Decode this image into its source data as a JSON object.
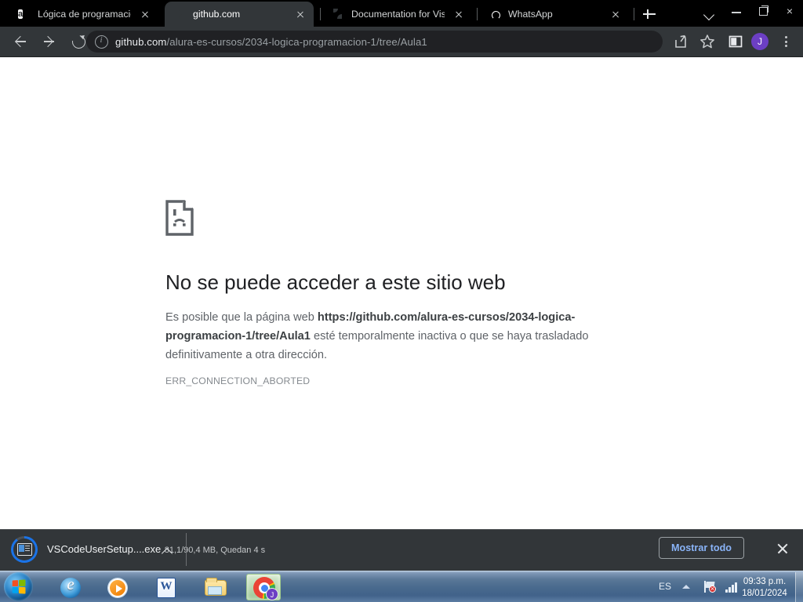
{
  "window": {
    "controls": {
      "minimize": "minimize-button",
      "restore": "restore-button",
      "close": "close-button",
      "close_glyph": "×"
    }
  },
  "tabs": [
    {
      "title": "Lógica de programación:",
      "favicon": "alura-icon",
      "favicon_letter": "a",
      "active": false
    },
    {
      "title": "github.com",
      "favicon": "globe-icon",
      "favicon_letter": "",
      "active": true
    },
    {
      "title": "Documentation for Visual",
      "favicon": "globe-icon",
      "favicon_letter": "",
      "active": false
    },
    {
      "title": "WhatsApp",
      "favicon": "whatsapp-icon",
      "favicon_letter": "",
      "active": false
    }
  ],
  "tabstrip": {
    "new_tab_label": "+",
    "tab_list_label": "⌄"
  },
  "toolbar": {
    "back_label": "←",
    "forward_label": "→",
    "reload_label": "↻",
    "url_domain": "github.com",
    "url_path": "/alura-es-cursos/2034-logica-programacion-1/tree/Aula1",
    "url_full": "github.com/alura-es-cursos/2034-logica-programacion-1/tree/Aula1",
    "share_label": "share-icon",
    "bookmark_label": "star-icon",
    "side_panel_label": "side-panel-icon",
    "avatar_letter": "J",
    "menu_label": "kebab-menu-icon"
  },
  "page": {
    "icon": "sad-page-icon",
    "title": "No se puede acceder a este sitio web",
    "body_prefix": "Es posible que la página web ",
    "body_url": "https://github.com/alura-es-cursos/2034-logica-programacion-1/tree/Aula1",
    "body_suffix": " esté temporalmente inactiva o que se haya trasladado definitivamente a otra dirección.",
    "error_code": "ERR_CONNECTION_ABORTED"
  },
  "download_shelf": {
    "file_name": "VSCodeUserSetup....exe",
    "status": "81,1/90,4 MB, Quedan 4 s",
    "progress_percent": 90,
    "caret_label": "chevron-up-icon",
    "show_all_label": "Mostrar todo",
    "close_label": "close-shelf-icon",
    "accent_color": "#1a73e8",
    "link_color": "#8ab4f8"
  },
  "taskbar": {
    "start_label": "start-button",
    "items": [
      {
        "name": "internet-explorer",
        "active": false
      },
      {
        "name": "windows-media-player",
        "active": false
      },
      {
        "name": "microsoft-word",
        "active": false
      },
      {
        "name": "file-explorer",
        "active": false
      },
      {
        "name": "google-chrome",
        "active": true,
        "badge_letter": "J"
      }
    ],
    "tray": {
      "language": "ES",
      "show_hidden_label": "show-hidden-icons",
      "network_label": "network-error-icon",
      "signal_label": "signal-bars-icon",
      "time": "09:33 p.m.",
      "date": "18/01/2024"
    }
  }
}
